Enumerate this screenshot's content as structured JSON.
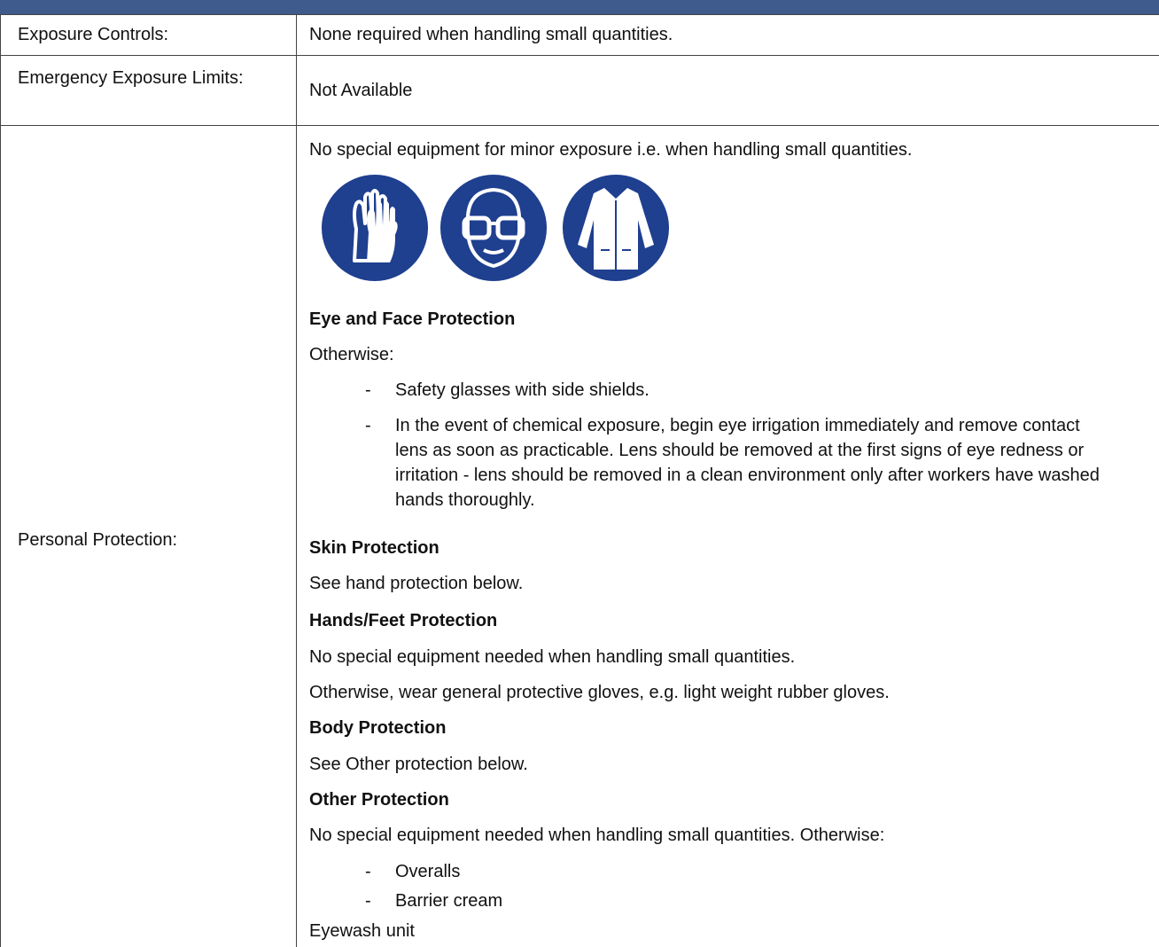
{
  "rows": [
    {
      "label": "Exposure Controls:",
      "value": "None required when handling small quantities."
    },
    {
      "label": "Emergency Exposure Limits:",
      "value": "Not Available"
    },
    {
      "label": "Personal Protection:"
    }
  ],
  "personal_protection": {
    "intro": "No special equipment for minor exposure i.e. when handling small quantities.",
    "icons": [
      "gloves-icon",
      "safety-glasses-icon",
      "lab-coat-icon"
    ],
    "icon_color": "#1f3f8f",
    "eye_face": {
      "heading": "Eye and Face Protection",
      "lead": "Otherwise:",
      "items": [
        "Safety glasses with side shields.",
        "In the event of chemical exposure, begin eye irrigation immediately and remove contact lens as soon as practicable. Lens should be removed at the first signs of eye redness or irritation - lens should be removed in a clean environment only after workers have washed hands thoroughly."
      ]
    },
    "skin": {
      "heading": "Skin Protection",
      "text": "See hand protection below."
    },
    "hands_feet": {
      "heading": "Hands/Feet Protection",
      "text1": "No special equipment needed when handling small quantities.",
      "text2": "Otherwise, wear general protective gloves, e.g. light weight rubber gloves."
    },
    "body": {
      "heading": "Body Protection",
      "text": "See Other protection below."
    },
    "other": {
      "heading": "Other Protection",
      "text": "No special equipment needed when handling small quantities. Otherwise:",
      "items": [
        "Overalls",
        "Barrier cream"
      ],
      "trailing": "Eyewash unit"
    }
  }
}
